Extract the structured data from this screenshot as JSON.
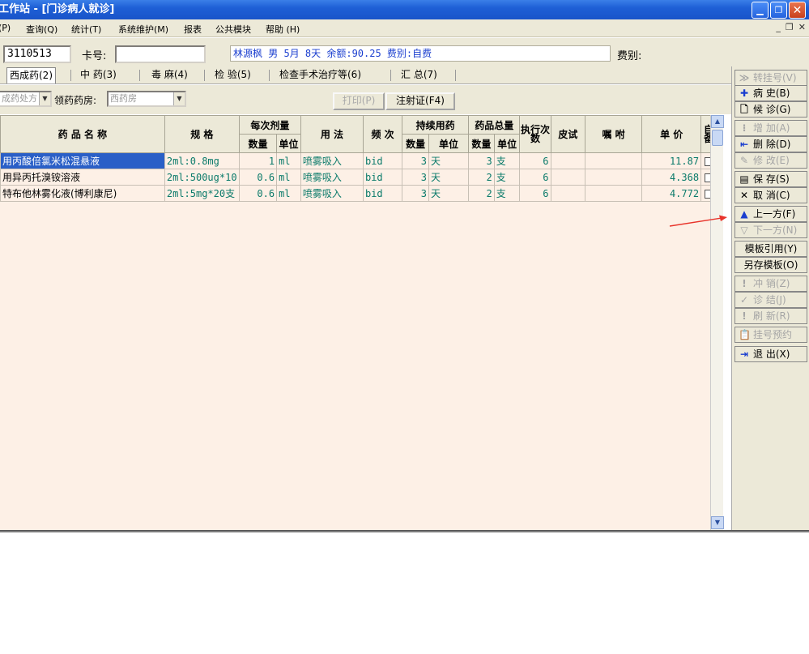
{
  "window": {
    "title": "工作站 - [门诊病人就诊]"
  },
  "menu": {
    "items": [
      "(P)",
      "查询(Q)",
      "统计(T)",
      "系统维护(M)",
      "报表",
      "公共模块",
      "帮助 (H)"
    ]
  },
  "info": {
    "id_value": "3110513",
    "card_label": "卡号:",
    "card_value": "",
    "patient_summary": "林源枫 男 5月 8天 余额:90.25 费别:自费",
    "fee_label": "费别:"
  },
  "tabs": [
    {
      "label": "西成药(2)"
    },
    {
      "label": "中 药(3)"
    },
    {
      "label": "毒 麻(4)"
    },
    {
      "label": "检 验(5)"
    },
    {
      "label": "检查手术治疗等(6)"
    },
    {
      "label": "汇 总(7)"
    }
  ],
  "rx": {
    "type_combo": "成药处方",
    "pharmacy_label": "领药药房:",
    "pharmacy_combo": "西药房",
    "print_button": "打印(P)",
    "injection_button": "注射证(F4)"
  },
  "table": {
    "headers": {
      "name": "药 品 名 称",
      "spec": "规 格",
      "dose": "每次剂量",
      "dose_qty": "数量",
      "dose_unit": "单位",
      "usage": "用 法",
      "freq": "频 次",
      "cont": "持续用药",
      "cont_qty": "数量",
      "cont_unit": "单位",
      "total": "药品总量",
      "total_qty": "数量",
      "total_unit": "单位",
      "exec": "执行次数",
      "skin": "皮试",
      "note": "嘱 咐",
      "price": "单 价",
      "self": "自备"
    },
    "rows": [
      {
        "name": "用丙酸倍氯米松混悬液",
        "spec": "2ml:0.8mg",
        "dose_qty": "1",
        "dose_unit": "ml",
        "usage": "喷雾吸入",
        "freq": "bid",
        "cont_qty": "3",
        "cont_unit": "天",
        "total_qty": "3",
        "total_unit": "支",
        "exec": "6",
        "skin": "",
        "note": "",
        "price": "11.87"
      },
      {
        "name": "用异丙托溴铵溶液",
        "spec": "2ml:500ug*10",
        "dose_qty": "0.6",
        "dose_unit": "ml",
        "usage": "喷雾吸入",
        "freq": "bid",
        "cont_qty": "3",
        "cont_unit": "天",
        "total_qty": "2",
        "total_unit": "支",
        "exec": "6",
        "skin": "",
        "note": "",
        "price": "4.368"
      },
      {
        "name": "特布他林雾化液(博利康尼)",
        "spec": "2ml:5mg*20支",
        "dose_qty": "0.6",
        "dose_unit": "ml",
        "usage": "喷雾吸入",
        "freq": "bid",
        "cont_qty": "3",
        "cont_unit": "天",
        "total_qty": "2",
        "total_unit": "支",
        "exec": "6",
        "skin": "",
        "note": "",
        "price": "4.772"
      }
    ]
  },
  "side": [
    {
      "icon": "double-chevron-right-icon",
      "glyph": "≫",
      "label": "转挂号(V)",
      "enabled": false
    },
    {
      "icon": "plus-icon",
      "glyph": "✚",
      "label": "病 史(B)",
      "enabled": true
    },
    {
      "icon": "document-icon",
      "glyph": "🗋",
      "label": "候 诊(G)",
      "enabled": true
    },
    {
      "icon": "add-row-icon",
      "glyph": "⁝",
      "label": "增 加(A)",
      "enabled": false
    },
    {
      "icon": "delete-row-icon",
      "glyph": "⇤",
      "label": "删 除(D)",
      "enabled": true
    },
    {
      "icon": "edit-icon",
      "glyph": "✎",
      "label": "修 改(E)",
      "enabled": false
    },
    {
      "icon": "save-icon",
      "glyph": "▤",
      "label": "保 存(S)",
      "enabled": true
    },
    {
      "icon": "cancel-icon",
      "glyph": "✕",
      "label": "取 消(C)",
      "enabled": true
    },
    {
      "icon": "up-arrow-icon",
      "glyph": "▲",
      "label": "上一方(F)",
      "enabled": true
    },
    {
      "icon": "down-arrow-icon",
      "glyph": "▽",
      "label": "下一方(N)",
      "enabled": false
    },
    {
      "icon": "",
      "glyph": "",
      "label": "模板引用(Y)",
      "enabled": true
    },
    {
      "icon": "",
      "glyph": "",
      "label": "另存模板(O)",
      "enabled": true
    },
    {
      "icon": "exclaim-icon",
      "glyph": "!",
      "label": "冲 销(Z)",
      "enabled": false
    },
    {
      "icon": "check-icon",
      "glyph": "✓",
      "label": "诊 结(J)",
      "enabled": false
    },
    {
      "icon": "exclaim-icon",
      "glyph": "!",
      "label": "刷 新(R)",
      "enabled": false
    },
    {
      "icon": "clipboard-icon",
      "glyph": "📋",
      "label": "挂号预约",
      "enabled": false
    },
    {
      "icon": "exit-icon",
      "glyph": "⇥",
      "label": "退 出(X)",
      "enabled": true
    }
  ],
  "colors": {
    "title_blue": "#1e5fd6",
    "grid_bg": "#fdf0e6",
    "selection": "#2a5fc7",
    "annotation_arrow": "#e8332a"
  }
}
